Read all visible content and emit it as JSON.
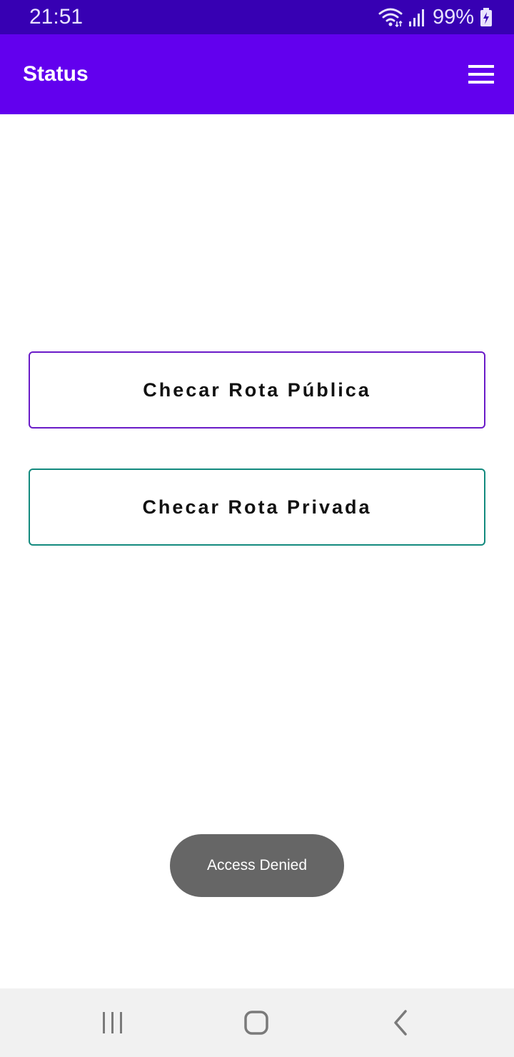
{
  "status_bar": {
    "time": "21:51",
    "battery": "99%",
    "icons": [
      "wifi-icon",
      "signal-icon",
      "battery-charging-icon"
    ]
  },
  "app_bar": {
    "title": "Status",
    "menu_icon": "hamburger-menu-icon"
  },
  "buttons": {
    "public_route": "Checar Rota Pública",
    "private_route": "Checar Rota Privada"
  },
  "toast": {
    "message": "Access Denied"
  },
  "nav_bar": {
    "icons": [
      "recents-icon",
      "home-icon",
      "back-icon"
    ]
  },
  "colors": {
    "status_bar": "#3700b3",
    "app_bar": "#6200ee",
    "public_border": "#6a1bc8",
    "private_border": "#138a7e",
    "toast": "#666666"
  }
}
